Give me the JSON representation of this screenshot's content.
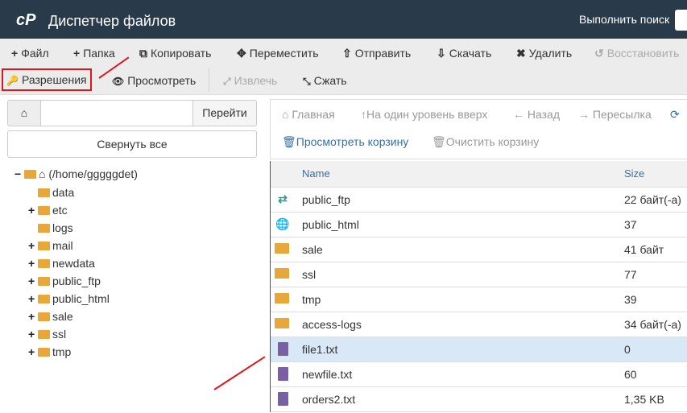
{
  "header": {
    "logo": "cP",
    "title": "Диспетчер файлов",
    "search_label": "Выполнить поиск"
  },
  "toolbar": {
    "row1": [
      {
        "icon": "plus-icon",
        "glyph": "+",
        "label": "Файл"
      },
      {
        "icon": "plus-icon",
        "glyph": "+",
        "label": "Папка"
      },
      {
        "icon": "copy-icon",
        "glyph": "⧉",
        "label": "Копировать"
      },
      {
        "icon": "move-icon",
        "glyph": "✥",
        "label": "Переместить"
      },
      {
        "icon": "upload-icon",
        "glyph": "⇧",
        "label": "Отправить"
      },
      {
        "icon": "download-icon",
        "glyph": "⇩",
        "label": "Скачать"
      },
      {
        "icon": "delete-icon",
        "glyph": "✖",
        "label": "Удалить"
      },
      {
        "icon": "restore-icon",
        "glyph": "↺",
        "label": "Восстановить",
        "disabled": true
      }
    ],
    "row2": [
      {
        "icon": "key-icon",
        "glyph": "🔑",
        "label": "Разрешения"
      },
      {
        "icon": "eye-icon",
        "glyph": "👁",
        "label": "Просмотреть"
      },
      {
        "icon": "extract-icon",
        "glyph": "⤢",
        "label": "Извлечь",
        "disabled": true
      },
      {
        "icon": "compress-icon",
        "glyph": "⤡",
        "label": "Сжать"
      }
    ]
  },
  "left": {
    "go_label": "Перейти",
    "collapse_label": "Свернуть все",
    "root": "(/home/gggggdet)",
    "tree": [
      {
        "name": "data",
        "exp": false
      },
      {
        "name": "etc",
        "exp": true
      },
      {
        "name": "logs",
        "exp": false
      },
      {
        "name": "mail",
        "exp": true
      },
      {
        "name": "newdata",
        "exp": true
      },
      {
        "name": "public_ftp",
        "exp": true
      },
      {
        "name": "public_html",
        "exp": true
      },
      {
        "name": "sale",
        "exp": true
      },
      {
        "name": "ssl",
        "exp": true
      },
      {
        "name": "tmp",
        "exp": true
      }
    ]
  },
  "nav": {
    "home": "Главная",
    "up": "На один уровень вверх",
    "back": "Назад",
    "forward": "Пересылка",
    "trash_view": "Просмотреть корзину",
    "trash_empty": "Очистить корзину"
  },
  "table": {
    "col_name": "Name",
    "col_size": "Size",
    "rows": [
      {
        "icon": "folder-share",
        "name": "public_ftp",
        "size": "22 байт(-а)"
      },
      {
        "icon": "globe",
        "name": "public_html",
        "size": "37"
      },
      {
        "icon": "folder",
        "name": "sale",
        "size": "41 байт"
      },
      {
        "icon": "folder",
        "name": "ssl",
        "size": "77"
      },
      {
        "icon": "folder",
        "name": "tmp",
        "size": "39"
      },
      {
        "icon": "folder",
        "name": "access-logs",
        "size": "34 байт(-а)"
      },
      {
        "icon": "file",
        "name": "file1.txt",
        "size": "0",
        "selected": true
      },
      {
        "icon": "file",
        "name": "newfile.txt",
        "size": "60"
      },
      {
        "icon": "file",
        "name": "orders2.txt",
        "size": "1,35 KB"
      }
    ]
  },
  "colors": {
    "header": "#293a4a",
    "highlight": "#e0161b",
    "folder": "#e8a73a",
    "selected_row": "#d9e8f6"
  }
}
